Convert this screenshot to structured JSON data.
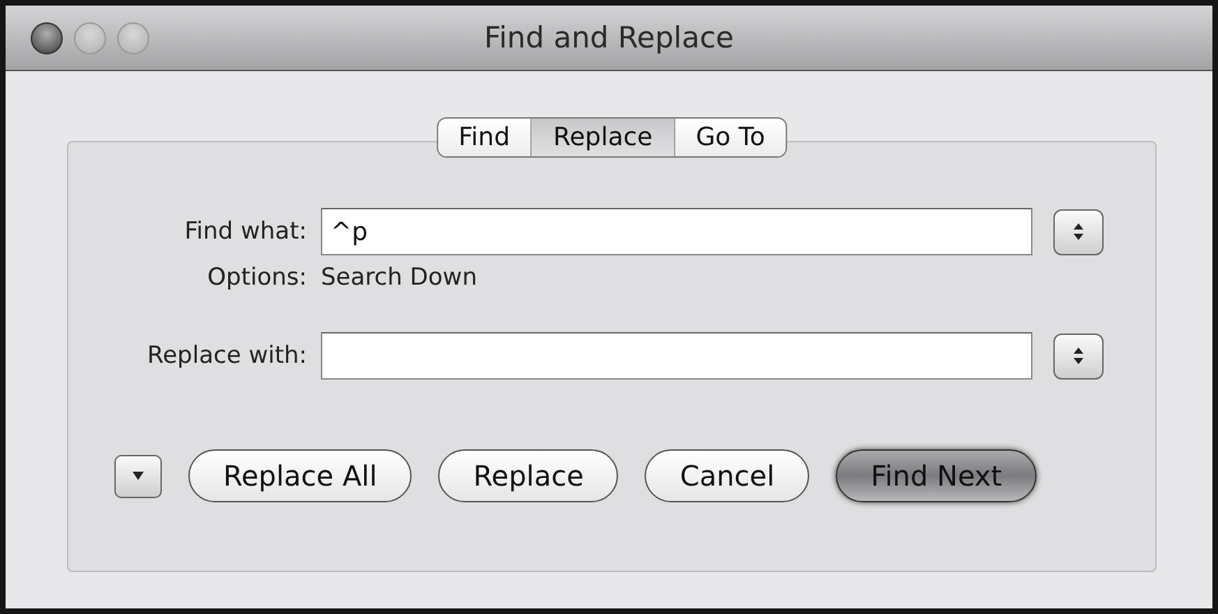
{
  "window": {
    "title": "Find and Replace"
  },
  "tabs": [
    {
      "label": "Find",
      "selected": false
    },
    {
      "label": "Replace",
      "selected": true
    },
    {
      "label": "Go To",
      "selected": false
    }
  ],
  "find_what": {
    "label": "Find what:",
    "value": "^p"
  },
  "options": {
    "label": "Options:",
    "value": "Search Down"
  },
  "replace_with": {
    "label": "Replace with:"
  },
  "expanded": false,
  "buttons": [
    {
      "label": "Replace All",
      "default": false
    },
    {
      "label": "Replace",
      "default": false
    },
    {
      "label": "Cancel",
      "default": false
    },
    {
      "label": "Find Next",
      "default": true
    }
  ]
}
